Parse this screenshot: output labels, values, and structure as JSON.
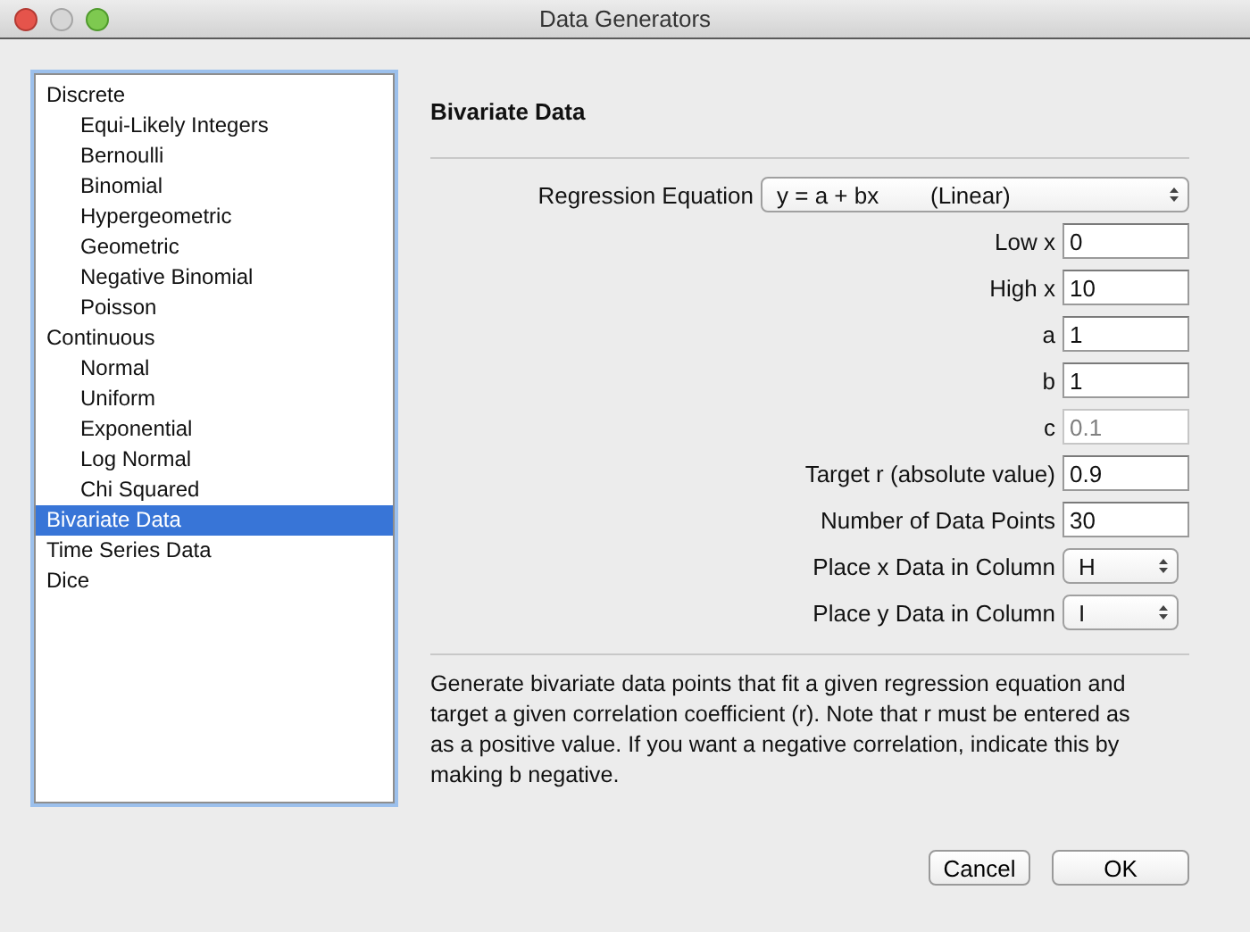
{
  "window": {
    "title": "Data Generators"
  },
  "sidebar": {
    "items": [
      {
        "label": "Discrete",
        "selected": false,
        "children": [
          {
            "label": "Equi-Likely Integers",
            "selected": false
          },
          {
            "label": "Bernoulli",
            "selected": false
          },
          {
            "label": "Binomial",
            "selected": false
          },
          {
            "label": "Hypergeometric",
            "selected": false
          },
          {
            "label": "Geometric",
            "selected": false
          },
          {
            "label": "Negative Binomial",
            "selected": false
          },
          {
            "label": "Poisson",
            "selected": false
          }
        ]
      },
      {
        "label": "Continuous",
        "selected": false,
        "children": [
          {
            "label": "Normal",
            "selected": false
          },
          {
            "label": "Uniform",
            "selected": false
          },
          {
            "label": "Exponential",
            "selected": false
          },
          {
            "label": "Log Normal",
            "selected": false
          },
          {
            "label": "Chi Squared",
            "selected": false
          }
        ]
      },
      {
        "label": "Bivariate Data",
        "selected": true
      },
      {
        "label": "Time Series Data",
        "selected": false
      },
      {
        "label": "Dice",
        "selected": false
      }
    ]
  },
  "panel": {
    "title": "Bivariate Data",
    "fields": [
      {
        "kind": "popup",
        "label": "Regression Equation",
        "value": "y = a + bx        (Linear)"
      },
      {
        "kind": "text",
        "label": "Low x",
        "value": "0",
        "disabled": false
      },
      {
        "kind": "text",
        "label": "High x",
        "value": "10",
        "disabled": false
      },
      {
        "kind": "text",
        "label": "a",
        "value": "1",
        "disabled": false
      },
      {
        "kind": "text",
        "label": "b",
        "value": "1",
        "disabled": false
      },
      {
        "kind": "text",
        "label": "c",
        "value": "0.1",
        "disabled": true
      },
      {
        "kind": "text",
        "label": "Target r (absolute value)",
        "value": "0.9",
        "disabled": false
      },
      {
        "kind": "text",
        "label": "Number of Data Points",
        "value": "30",
        "disabled": false
      },
      {
        "kind": "select",
        "label": "Place x Data in Column",
        "value": "H"
      },
      {
        "kind": "select",
        "label": "Place y Data in Column",
        "value": "I"
      }
    ],
    "description": "Generate bivariate data points that fit a given regression equation and target a given correlation coefficient (r).  Note that r must be entered as as a positive value.  If you want a negative correlation, indicate this by making b negative."
  },
  "buttons": [
    {
      "label": "Cancel",
      "default": false
    },
    {
      "label": "OK",
      "default": false
    }
  ]
}
